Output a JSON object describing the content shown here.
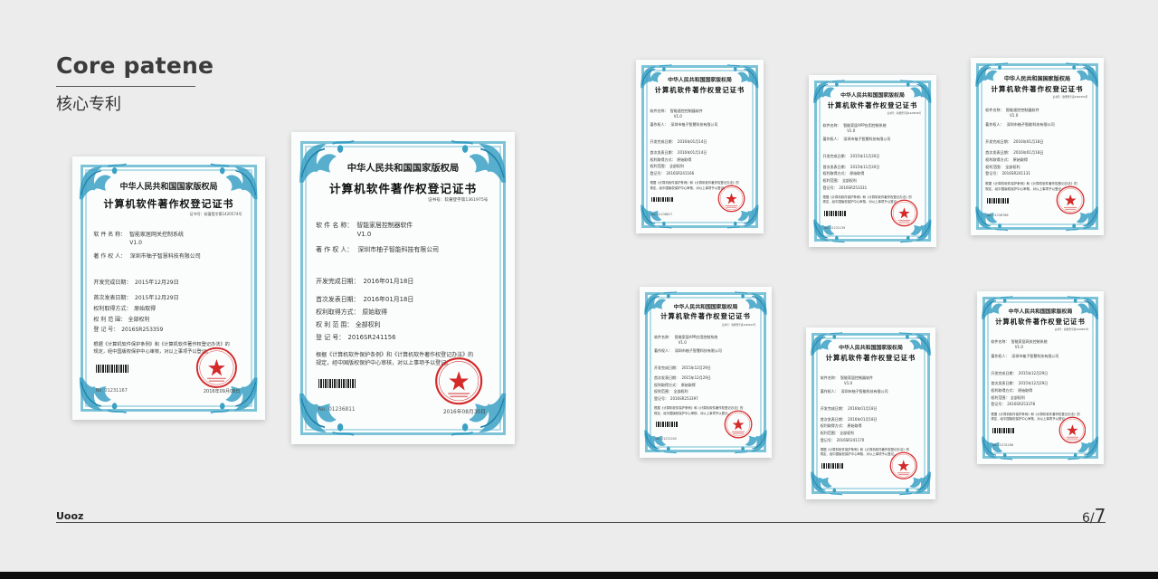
{
  "header": {
    "title_en": "Core patene",
    "title_cn": "核心专利"
  },
  "footer": {
    "brand": "Uooz",
    "page_current": "6",
    "page_separator": "/",
    "page_total": "7"
  },
  "colors": {
    "frame": "#7cc3d8",
    "ornament": "#3aa0c4",
    "seal": "#d42a2a",
    "text": "#3b3b3b"
  },
  "certificates": [
    {
      "authority": "中华人民共和国国家版权局",
      "heading": "计算机软件著作权登记证书",
      "reg_no": "证书号：软著登字第1420574号",
      "software_label": "软 件 名 称：",
      "software_name": "智能家居网关控制系统",
      "version": "V1.0",
      "owner_label": "著 作 权 人：",
      "owner": "深圳市柚子智慧科技有限公司",
      "dev_label": "开发完成日期：",
      "dev_date": "2015年12月29日",
      "pub_label": "首次发表日期：",
      "pub_date": "2015年12月29日",
      "method_label": "权利取得方式：",
      "method": "原始取得",
      "scope_label": "权 利 范 围：",
      "scope": "全部权利",
      "regnum_label": "登 记 号：",
      "regnum": "2016SR253359",
      "body1": "根据《计算机软件保护条例》和《计算机软件著作权登记办法》的",
      "body2": "规定，经中国版权保护中心审核，对以上事项予以登记。",
      "cert_no": "No. 01231167",
      "issue_date": "2016年09月08日"
    },
    {
      "authority": "中华人民共和国国家版权局",
      "heading": "计算机软件著作权登记证书",
      "reg_no": "证书号：软著登字第1361975号",
      "software_label": "软 件 名 称：",
      "software_name": "智能家居控制器软件",
      "version": "V1.0",
      "owner_label": "著 作 权 人：",
      "owner": "深圳市柚子智能科技有限公司",
      "dev_label": "开发完成日期：",
      "dev_date": "2016年01月18日",
      "pub_label": "首次发表日期：",
      "pub_date": "2016年01月18日",
      "method_label": "权利取得方式：",
      "method": "原始取得",
      "scope_label": "权 利 范 围：",
      "scope": "全部权利",
      "regnum_label": "登 记 号：",
      "regnum": "2016SR241156",
      "body1": "根据《计算机软件保护条例》和《计算机软件著作权登记办法》的",
      "body2": "规定，经中国版权保护中心审核，对以上事项予以登记。",
      "cert_no": "No. 01236811",
      "issue_date": "2016年08月30日"
    },
    {
      "authority": "中华人民共和国国家版权局",
      "heading": "计算机软件著作权登记证书",
      "reg_no": "",
      "software_label": "软件名称：",
      "software_name": "智能遥控控制器软件",
      "version": "V1.0",
      "owner_label": "著作权人：",
      "owner": "深圳市柚子智慧科技有限公司",
      "dev_label": "开发完成日期：",
      "dev_date": "2016年01月14日",
      "pub_label": "首次发表日期：",
      "pub_date": "2016年01月14日",
      "method_label": "权利取得方式：",
      "method": "原始取得",
      "scope_label": "权利范围：",
      "scope": "全部权利",
      "regnum_label": "登记号：",
      "regnum": "2016SR241166",
      "body1": "根据《计算机软件保护条例》和《计算机软件著作权登记办法》的",
      "body2": "规定，经中国版权保护中心审核，对以上事项予以登记。",
      "cert_no": "No. 01236817",
      "issue_date": ""
    },
    {
      "authority": "中华人民共和国国家版权局",
      "heading": "计算机软件著作权登记证书",
      "reg_no": "证书号：软著登字第1420546号",
      "software_label": "软件名称：",
      "software_name": "智能家居APP应用控制系统",
      "version": "V1.0",
      "owner_label": "著作权人：",
      "owner": "深圳市柚子智慧科技有限公司",
      "dev_label": "开发完成日期：",
      "dev_date": "2015年11月30日",
      "pub_label": "首次发表日期：",
      "pub_date": "2015年11月30日",
      "method_label": "权利取得方式：",
      "method": "原始取得",
      "scope_label": "权利范围：",
      "scope": "全部权利",
      "regnum_label": "登记号：",
      "regnum": "2016SR253331",
      "body1": "根据《计算机软件保护条例》和《计算机软件著作权登记办法》的",
      "body2": "规定，经中国版权保护中心审核，对以上事项予以登记。",
      "cert_no": "No. 01231139",
      "issue_date": ""
    },
    {
      "authority": "中华人民共和国国家版权局",
      "heading": "计算机软件著作权登记证书",
      "reg_no": "证书号：软著登字第1361950号",
      "software_label": "软件名称：",
      "software_name": "智能遥控控制器软件",
      "version": "V1.0",
      "owner_label": "著作权人：",
      "owner": "深圳市柚子智能科技有限公司",
      "dev_label": "开发完成日期：",
      "dev_date": "2016年01月18日",
      "pub_label": "首次发表日期：",
      "pub_date": "2016年01月18日",
      "method_label": "权利取得方式：",
      "method": "原始取得",
      "scope_label": "权利范围：",
      "scope": "全部权利",
      "regnum_label": "登记号：",
      "regnum": "2016SR241131",
      "body1": "根据《计算机软件保护条例》和《计算机软件著作权登记办法》的",
      "body2": "规定，经中国版权保护中心审核，对以上事项予以登记。",
      "cert_no": "No. 01236786",
      "issue_date": ""
    },
    {
      "authority": "中华人民共和国国家版权局",
      "heading": "计算机软件著作权登记证书",
      "reg_no": "证书号：软著登字第1420612号",
      "software_label": "软件名称：",
      "software_name": "智能家居APP应用控制系统",
      "version": "V1.0",
      "owner_label": "著作权人：",
      "owner": "深圳市柚子智慧科技有限公司",
      "dev_label": "开发完成日期：",
      "dev_date": "2015年12月29日",
      "pub_label": "首次发表日期：",
      "pub_date": "2015年12月29日",
      "method_label": "权利取得方式：",
      "method": "原始取得",
      "scope_label": "权利范围：",
      "scope": "全部权利",
      "regnum_label": "登记号：",
      "regnum": "2016SR253397",
      "body1": "根据《计算机软件保护条例》和《计算机软件著作权登记办法》的",
      "body2": "规定，经中国版权保护中心审核，对以上事项予以登记。",
      "cert_no": "No. 01231205",
      "issue_date": ""
    },
    {
      "authority": "中华人民共和国国家版权局",
      "heading": "计算机软件著作权登记证书",
      "reg_no": "",
      "software_label": "软件名称：",
      "software_name": "智能家居控制器软件",
      "version": "V1.0",
      "owner_label": "著作权人：",
      "owner": "深圳市柚子智能科技有限公司",
      "dev_label": "开发完成日期：",
      "dev_date": "2016年01月18日",
      "pub_label": "首次发表日期：",
      "pub_date": "2016年01月18日",
      "method_label": "权利取得方式：",
      "method": "原始取得",
      "scope_label": "权利范围：",
      "scope": "全部权利",
      "regnum_label": "登记号：",
      "regnum": "2016SR241170",
      "body1": "根据《计算机软件保护条例》和《计算机软件著作权登记办法》的",
      "body2": "规定，经中国版权保护中心审核，对以上事项予以登记。",
      "cert_no": "",
      "issue_date": ""
    },
    {
      "authority": "中华人民共和国国家版权局",
      "heading": "计算机软件著作权登记证书",
      "reg_no": "证书号：软著登字第1420593号",
      "software_label": "软件名称：",
      "software_name": "智能家居网关控制系统",
      "version": "V1.0",
      "owner_label": "著作权人：",
      "owner": "深圳市柚子智慧科技有限公司",
      "dev_label": "开发完成日期：",
      "dev_date": "2015年12月29日",
      "pub_label": "首次发表日期：",
      "pub_date": "2015年12月29日",
      "method_label": "权利取得方式：",
      "method": "原始取得",
      "scope_label": "权利范围：",
      "scope": "全部权利",
      "regnum_label": "登记号：",
      "regnum": "2016SR253378",
      "body1": "根据《计算机软件保护条例》和《计算机软件著作权登记办法》的",
      "body2": "规定，经中国版权保护中心审核，对以上事项予以登记。",
      "cert_no": "No. 01231186",
      "issue_date": ""
    }
  ]
}
